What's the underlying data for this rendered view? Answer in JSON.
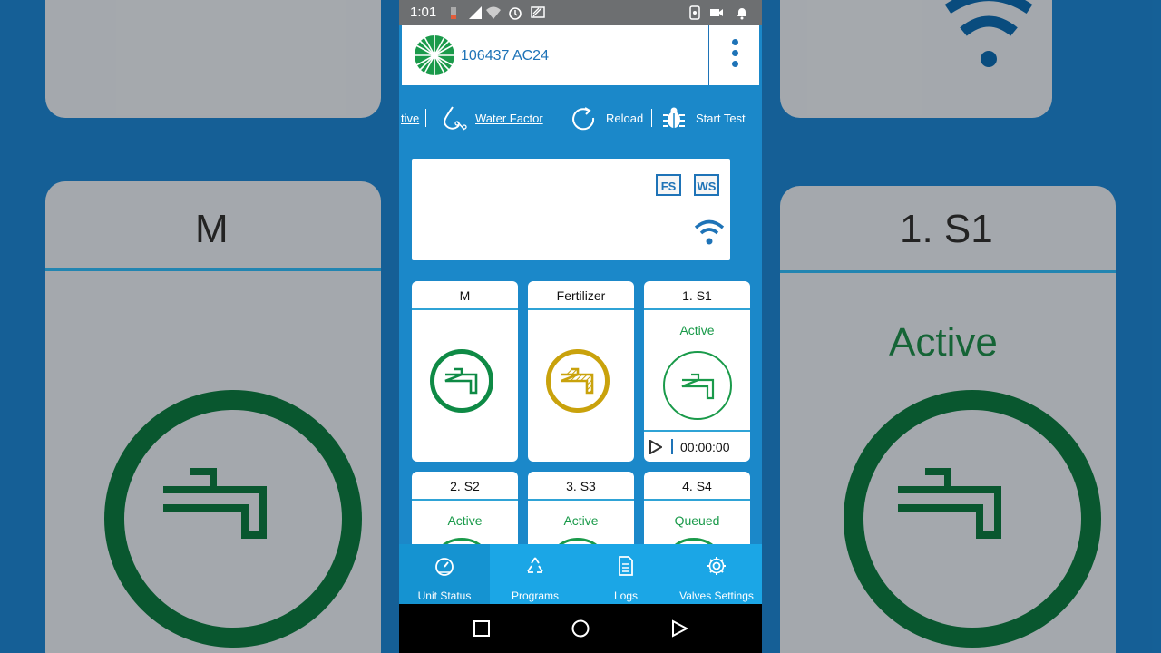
{
  "status_bar": {
    "time": "1:01"
  },
  "app_bar": {
    "title": "106437 AC24"
  },
  "toolbar": {
    "items": [
      {
        "label": "tive"
      },
      {
        "label": "Water Factor"
      },
      {
        "label": "Reload"
      },
      {
        "label": "Start Test"
      }
    ]
  },
  "display_panel": {
    "badges": [
      "FS",
      "WS"
    ]
  },
  "tiles": [
    {
      "name": "M",
      "state": ""
    },
    {
      "name": "Fertilizer",
      "state": ""
    },
    {
      "name": "1. S1",
      "state": "Active",
      "timer": "00:00:00"
    },
    {
      "name": "2. S2",
      "state": "Active"
    },
    {
      "name": "3. S3",
      "state": "Active"
    },
    {
      "name": "4. S4",
      "state": "Queued"
    }
  ],
  "bottom_nav": {
    "items": [
      {
        "label": "Unit Status"
      },
      {
        "label": "Programs"
      },
      {
        "label": "Logs"
      },
      {
        "label": "Valves Settings"
      }
    ]
  },
  "background_mirror": {
    "left_label": "M",
    "right_label": "1. S1",
    "right_state": "Active"
  },
  "colors": {
    "primary": "#1e73b7",
    "screen_bg": "#1b88c9",
    "bottom_nav": "#1ba6e6",
    "valve_green": "#0e8a45",
    "fertilizer_gold": "#c9a20c",
    "active_text": "#1a9a4a"
  }
}
